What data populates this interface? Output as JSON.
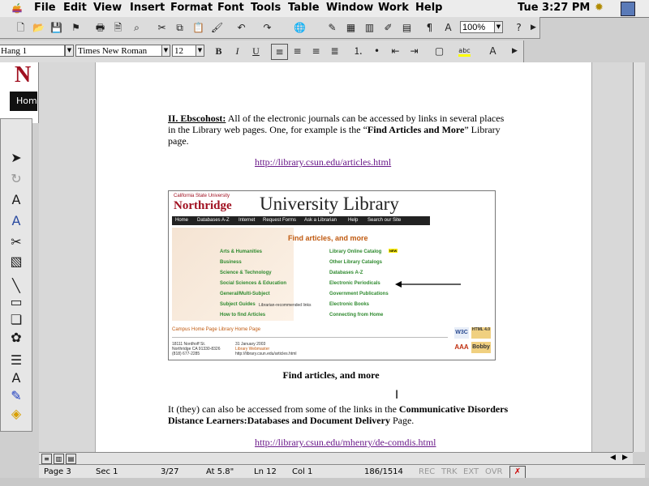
{
  "menubar": {
    "items": [
      "File",
      "Edit",
      "View",
      "Insert",
      "Format",
      "Font",
      "Tools",
      "Table",
      "Window",
      "Work",
      "Help"
    ],
    "clock": "Tue 3:27 PM"
  },
  "toolbar": {
    "zoom": "100%"
  },
  "formatting": {
    "style": "Hang 1",
    "font": "Times New Roman",
    "size": "12"
  },
  "left_strip": {
    "home_tab": "Hom"
  },
  "document": {
    "para1_heading": "II. Ebscohost:",
    "para1_text": " All of the electronic journals can be accessed by links in several places in the Library web pages.  One, for example is the “",
    "para1_bold": "Find Articles and More",
    "para1_end": "” Library page.",
    "link1": "http://library.csun.edu/articles.html",
    "caption": "Find articles, and more",
    "para2_start": "It (they) can also be accessed from some of the links in the ",
    "para2_bold": "Communicative Disorders Distance Learners:Databases and Document Delivery",
    "para2_end": " Page.",
    "link2": "http://library.csun.edu/mhenry/de-comdis.html"
  },
  "web_screenshot": {
    "csun_top": "California State University",
    "csun_name": "Northridge",
    "banner": "University Library",
    "nav": [
      "Home",
      "Databases A-Z",
      "Internet",
      "Request Forms",
      "Ask a Librarian",
      "Help",
      "Search our Site"
    ],
    "heading": "Find articles, and more",
    "left_links": [
      "Arts & Humanities",
      "Business",
      "Science & Technology",
      "Social Sciences & Education",
      "General/Multi-Subject",
      "Subject Guides",
      "How to find Articles"
    ],
    "subject_guides_note": "Librarian-recommended links",
    "right_links": [
      "Library Online Catalog",
      "Other Library Catalogs",
      "Databases A-Z",
      "Electronic Periodicals",
      "Government Publications",
      "Electronic Books",
      "Connecting from Home"
    ],
    "new_badge": "NEW",
    "footer_links": "Campus Home Page   Library Home Page",
    "address": [
      "18111 Nordhoff St.",
      "Northridge CA 91330-8326",
      "(818) 677-2285"
    ],
    "date": "31 January 2003",
    "webmaster": "Library Webmaster",
    "url": "http://library.csun.edu/articles.html",
    "badge_html": "HTML 4.0",
    "badge_bobby": "Bobby",
    "badge_w3c": "W3C",
    "badge_aaa": "AAA"
  },
  "status": {
    "page": "Page 3",
    "sec": "Sec 1",
    "pages": "3/27",
    "at": "At 5.8\"",
    "ln": "Ln 12",
    "col": "Col 1",
    "words": "186/1514",
    "rec": "REC",
    "trk": "TRK",
    "ext": "EXT",
    "ovr": "OVR"
  }
}
